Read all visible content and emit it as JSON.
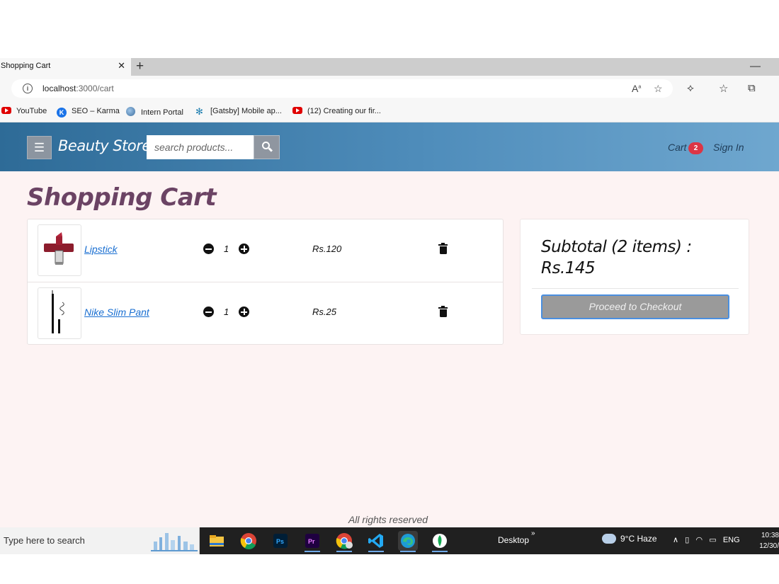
{
  "browser": {
    "tab_title": "Shopping Cart",
    "tab_close": "✕",
    "new_tab": "+",
    "minimize": "—",
    "address_host": "localhost",
    "address_path": ":3000/cart",
    "bookmarks": [
      {
        "label": "YouTube",
        "icon": "youtube-icon"
      },
      {
        "label": "SEO – Karma",
        "icon": "karma-icon"
      },
      {
        "label": "Intern Portal",
        "icon": "globe-icon"
      },
      {
        "label": "[Gatsby] Mobile ap...",
        "icon": "snowflake-icon"
      },
      {
        "label": "(12) Creating our fir...",
        "icon": "youtube-icon"
      }
    ]
  },
  "navbar": {
    "menu_icon": "☰",
    "brand": "Beauty Store",
    "search_placeholder": "search products...",
    "cart_label": "Cart",
    "cart_count": "2",
    "signin_label": "Sign In"
  },
  "page": {
    "title": "Shopping Cart",
    "items": [
      {
        "name": "Lipstick",
        "qty": "1",
        "price": "Rs.120",
        "image": "lipstick-image"
      },
      {
        "name": "Nike Slim Pant",
        "qty": "1",
        "price": "Rs.25",
        "image": "eyeliner-image"
      }
    ],
    "summary": {
      "subtotal_line1": "Subtotal (2 items) :",
      "subtotal_line2": "Rs.145",
      "checkout_label": "Proceed to Checkout"
    },
    "footer": "All rights reserved"
  },
  "taskbar": {
    "search_placeholder": "Type here to search",
    "desktop_label": "Desktop",
    "chevron": "»",
    "weather": "9°C  Haze",
    "tray_lang": "ENG",
    "clock_time": "10:38",
    "clock_date": "12/30/"
  },
  "colors": {
    "navbar_start": "#2e6b97",
    "navbar_end": "#6fa7cf",
    "page_bg": "#fdf3f3",
    "title": "#6b4364",
    "link": "#1a6fd1",
    "badge": "#dc3545",
    "checkout_bg": "#9a9a9a"
  }
}
